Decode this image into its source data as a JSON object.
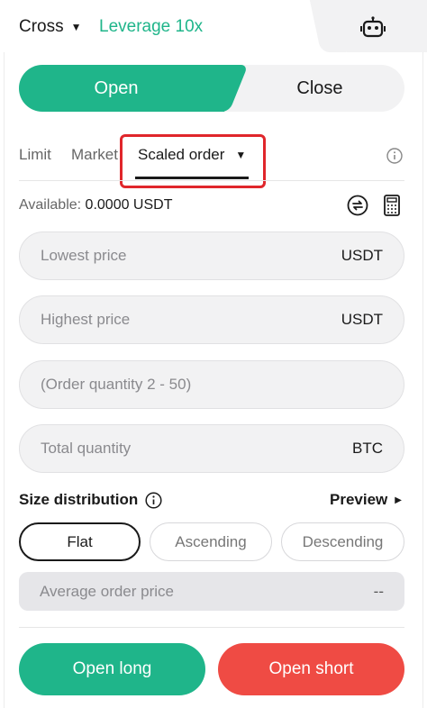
{
  "header": {
    "margin_mode": "Cross",
    "leverage": "Leverage 10x",
    "robot_icon": "robot-icon"
  },
  "side_toggle": {
    "open_label": "Open",
    "close_label": "Close",
    "selected": "Open"
  },
  "order_tabs": {
    "items": [
      {
        "label": "Limit"
      },
      {
        "label": "Market"
      },
      {
        "label": "Scaled order"
      }
    ],
    "selected": "Scaled order",
    "info_icon": "info-icon"
  },
  "available": {
    "label": "Available:",
    "value": "0.0000 USDT",
    "swap_icon": "swap-icon",
    "calculator_icon": "calculator-icon"
  },
  "fields": {
    "lowest_price": {
      "placeholder": "Lowest price",
      "unit": "USDT"
    },
    "highest_price": {
      "placeholder": "Highest price",
      "unit": "USDT"
    },
    "order_quantity": {
      "placeholder": "(Order quantity 2 - 50)",
      "unit": ""
    },
    "total_quantity": {
      "placeholder": "Total quantity",
      "unit": "BTC"
    }
  },
  "size_distribution": {
    "label": "Size distribution",
    "preview_label": "Preview",
    "options": [
      {
        "label": "Flat"
      },
      {
        "label": "Ascending"
      },
      {
        "label": "Descending"
      }
    ],
    "selected": "Flat"
  },
  "average_order_price": {
    "label": "Average order price",
    "value": "--"
  },
  "actions": {
    "open_long": "Open long",
    "open_short": "Open short"
  },
  "colors": {
    "accent_green": "#1fb58a",
    "short_red": "#ef4b44",
    "highlight_red": "#e0262b"
  }
}
